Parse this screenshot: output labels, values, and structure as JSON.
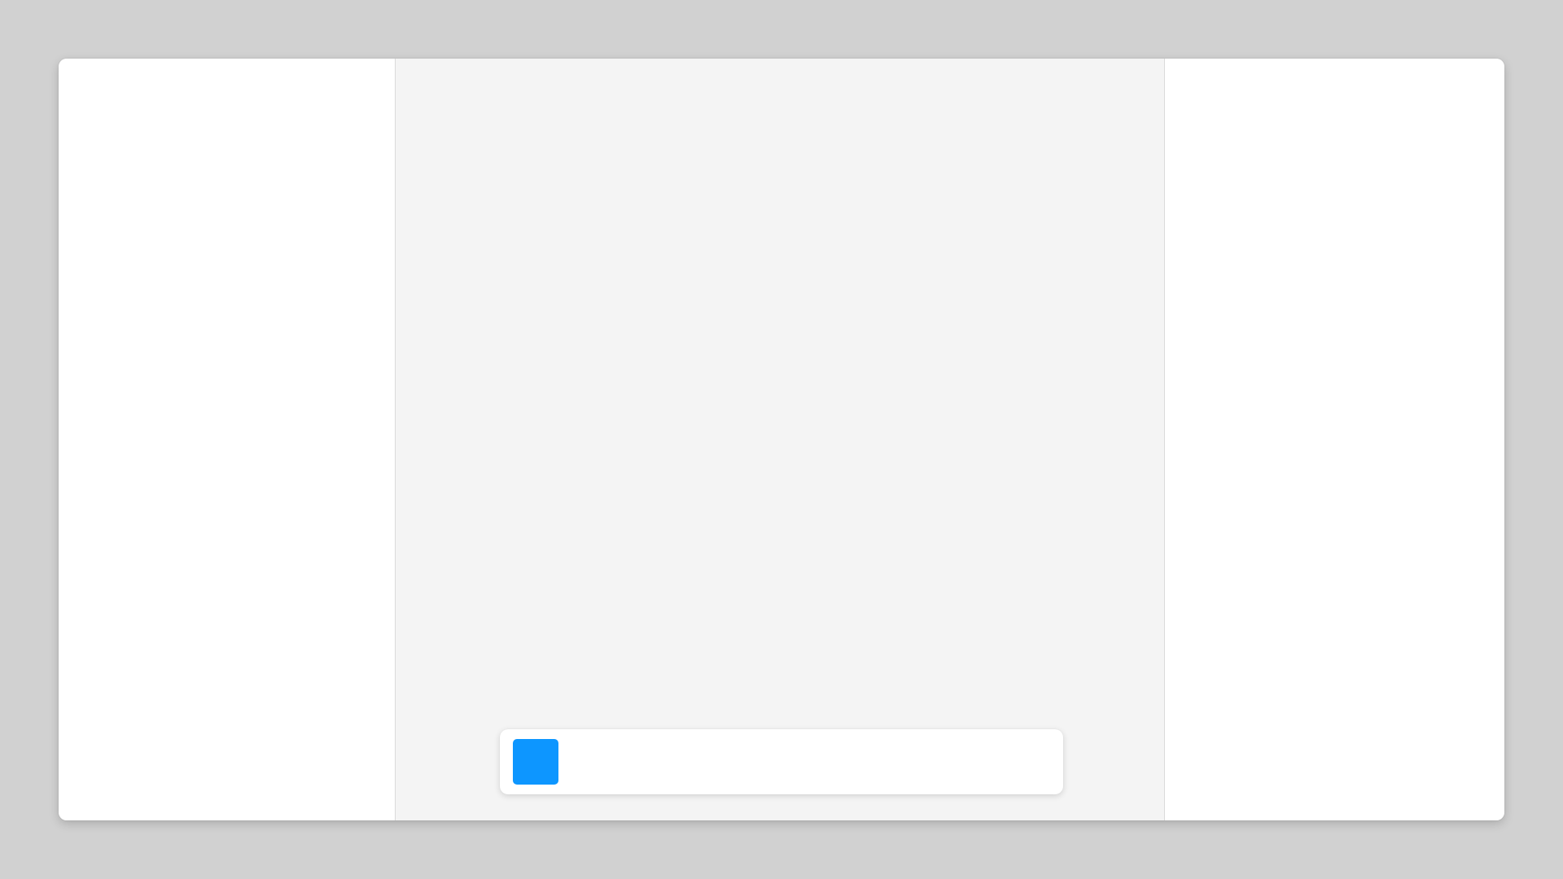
{
  "colors": {
    "desktop_background": "#d1d1d1",
    "window_background": "#ffffff",
    "center_pane_background": "#f4f4f4",
    "accent": "#0d96ff"
  },
  "bottom_bar": {
    "accent_button_color": "#0d96ff"
  }
}
